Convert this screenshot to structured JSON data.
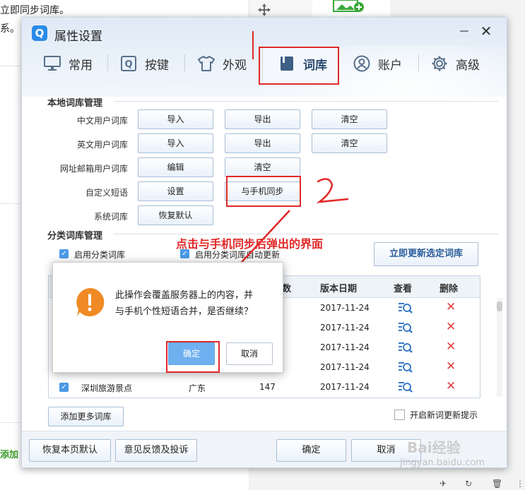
{
  "background": {
    "text1": "立即同步词库。",
    "text2": "系。",
    "text3": "添加",
    "move_icon": "move-icon",
    "image_icon": "image-add-icon"
  },
  "window": {
    "title": "属性设置",
    "logo": "Q",
    "minimize": "－",
    "close": "✕"
  },
  "tabs": [
    {
      "label": "常用",
      "icon": "monitor-icon"
    },
    {
      "label": "按键",
      "icon": "key-icon"
    },
    {
      "label": "外观",
      "icon": "shirt-icon"
    },
    {
      "label": "词库",
      "icon": "book-icon"
    },
    {
      "label": "账户",
      "icon": "user-icon"
    },
    {
      "label": "高级",
      "icon": "gear-icon"
    }
  ],
  "local": {
    "title": "本地词库管理",
    "rows": [
      {
        "label": "中文用户词库",
        "buttons": [
          "导入",
          "导出",
          "清空"
        ]
      },
      {
        "label": "英文用户词库",
        "buttons": [
          "导入",
          "导出",
          "清空"
        ]
      },
      {
        "label": "网址邮箱用户词库",
        "buttons": [
          "编辑",
          "清空"
        ]
      },
      {
        "label": "自定义短语",
        "buttons": [
          "设置",
          "与手机同步"
        ]
      },
      {
        "label": "系统词库",
        "buttons": [
          "恢复默认"
        ]
      }
    ]
  },
  "category": {
    "title": "分类词库管理",
    "enable_label": "启用分类词库",
    "auto_update_label": "启用分类词库自动更新",
    "update_button": "立即更新选定词库"
  },
  "table": {
    "headers": {
      "count": "数",
      "date": "版本日期",
      "view": "查看",
      "delete": "删除"
    },
    "rows": [
      {
        "date": "2017-11-24"
      },
      {
        "date": "2017-11-24"
      },
      {
        "date": "2017-11-24"
      },
      {
        "date": "2017-11-24"
      },
      {
        "name": "深圳旅游景点",
        "region": "广东",
        "count": "147",
        "date": "2017-11-24"
      }
    ]
  },
  "add_more": "添加更多词库",
  "new_dict_hint": "开启新词更新提示",
  "footer": {
    "restore": "恢复本页默认",
    "feedback": "意见反馈及投诉",
    "ok": "确定",
    "cancel": "取消"
  },
  "dialog": {
    "line1": "此操作会覆盖服务器上的内容，并",
    "line2": "与手机个性短语合并，是否继续？",
    "ok": "确定",
    "cancel": "取消",
    "icon": "warning-icon"
  },
  "annotation": {
    "text": "点击与手机同步后弹出的界面"
  },
  "watermark": {
    "brand": "Bai经验",
    "url": "jingyan.baidu.com"
  },
  "colors": {
    "accent": "#2a8be8",
    "annotation": "#e12828",
    "warning": "#f08a24"
  }
}
